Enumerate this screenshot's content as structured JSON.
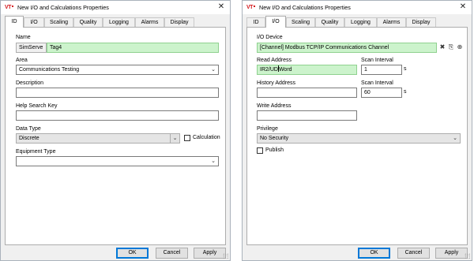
{
  "left_dialog": {
    "title": "New I/O and Calculations Properties",
    "tabs": [
      "ID",
      "I/O",
      "Scaling",
      "Quality",
      "Logging",
      "Alarms",
      "Display"
    ],
    "active_tab": "ID",
    "name_label": "Name",
    "name_prefix": "SimServe",
    "name_value": "Tag4",
    "area_label": "Area",
    "area_value": "Communications Testing",
    "description_label": "Description",
    "description_value": "",
    "help_label": "Help Search Key",
    "help_value": "",
    "datatype_label": "Data Type",
    "datatype_value": "Discrete",
    "calculation_label": "Calculation",
    "equipment_label": "Equipment Type",
    "equipment_value": ""
  },
  "right_dialog": {
    "title": "New I/O and Calculations Properties",
    "tabs": [
      "ID",
      "I/O",
      "Scaling",
      "Quality",
      "Logging",
      "Alarms",
      "Display"
    ],
    "active_tab": "I/O",
    "io_device_label": "I/O Device",
    "io_device_value": "[Channel]    Modbus TCP/IP Communications Channel",
    "read_address_label": "Read Address",
    "read_address_before_cursor": "IR2/UD",
    "read_address_after_cursor": "Word",
    "scan_interval_label": "Scan Interval",
    "scan_interval_1": "1",
    "history_address_label": "History Address",
    "history_address_value": "",
    "scan_interval_2_label": "Scan Interval",
    "scan_interval_2": "60",
    "unit": "s",
    "write_address_label": "Write Address",
    "write_address_value": "",
    "privilege_label": "Privilege",
    "privilege_value": "No Security",
    "publish_label": "Publish"
  },
  "buttons": {
    "ok": "OK",
    "cancel": "Cancel",
    "apply": "Apply"
  },
  "brand": {
    "icon_text": "VT",
    "icon_color": "#d4171c",
    "field_green": "#ccf3cc",
    "default_border": "#0078d7"
  }
}
